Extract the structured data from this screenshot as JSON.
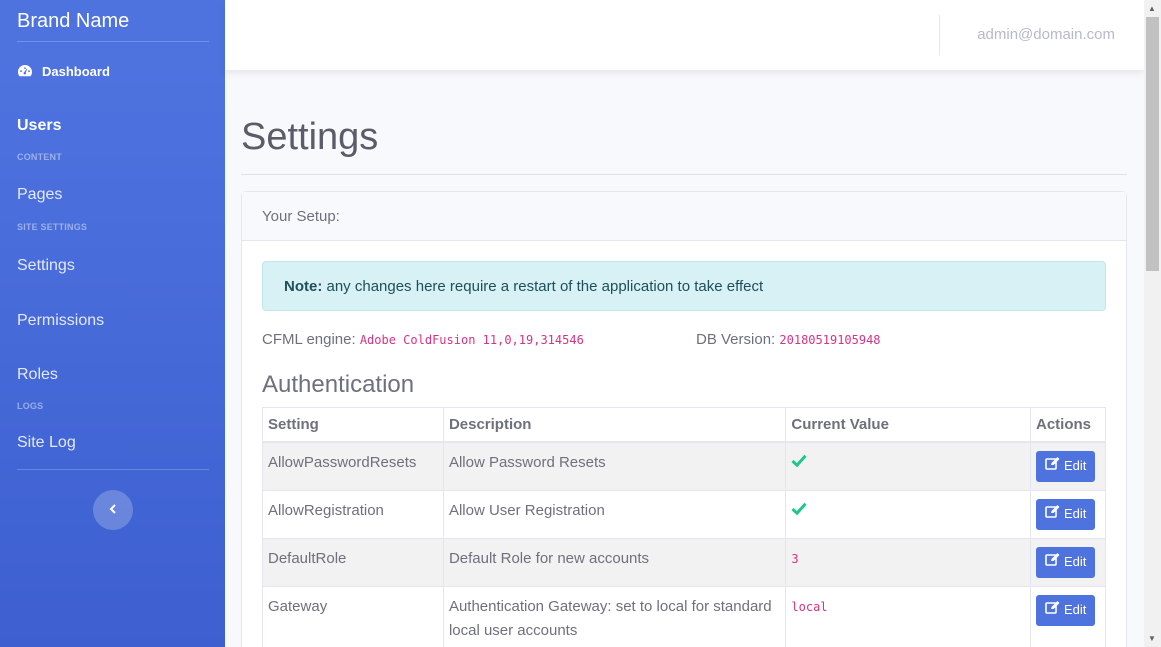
{
  "brand": "Brand Name",
  "user_email": "admin@domain.com",
  "sidebar": {
    "dashboard": "Dashboard",
    "users": "Users",
    "heading_content": "CONTENT",
    "pages": "Pages",
    "heading_site_settings": "SITE SETTINGS",
    "settings": "Settings",
    "permissions": "Permissions",
    "roles": "Roles",
    "heading_logs": "LOGS",
    "site_log": "Site Log"
  },
  "page": {
    "title": "Settings",
    "card_header": "Your Setup:",
    "note_label": "Note:",
    "note_text": " any changes here require a restart of the application to take effect",
    "cfml_label": "CFML engine:",
    "cfml_value": "Adobe ColdFusion 11,0,19,314546",
    "db_label": "DB Version:",
    "db_value": "20180519105948",
    "section_title": "Authentication"
  },
  "table": {
    "headers": [
      "Setting",
      "Description",
      "Current Value",
      "Actions"
    ],
    "edit_label": "Edit",
    "rows": [
      {
        "setting": "AllowPasswordResets",
        "description": "Allow Password Resets",
        "value": "",
        "value_type": "check"
      },
      {
        "setting": "AllowRegistration",
        "description": "Allow User Registration",
        "value": "",
        "value_type": "check"
      },
      {
        "setting": "DefaultRole",
        "description": "Default Role for new accounts",
        "value": "3",
        "value_type": "code"
      },
      {
        "setting": "Gateway",
        "description": "Authentication Gateway: set to local for standard local user accounts",
        "value": "local",
        "value_type": "code"
      }
    ]
  },
  "colors": {
    "primary": "#4e73df",
    "success": "#1cc88a",
    "code": "#d63384",
    "alert_bg": "#d7f1f5"
  }
}
